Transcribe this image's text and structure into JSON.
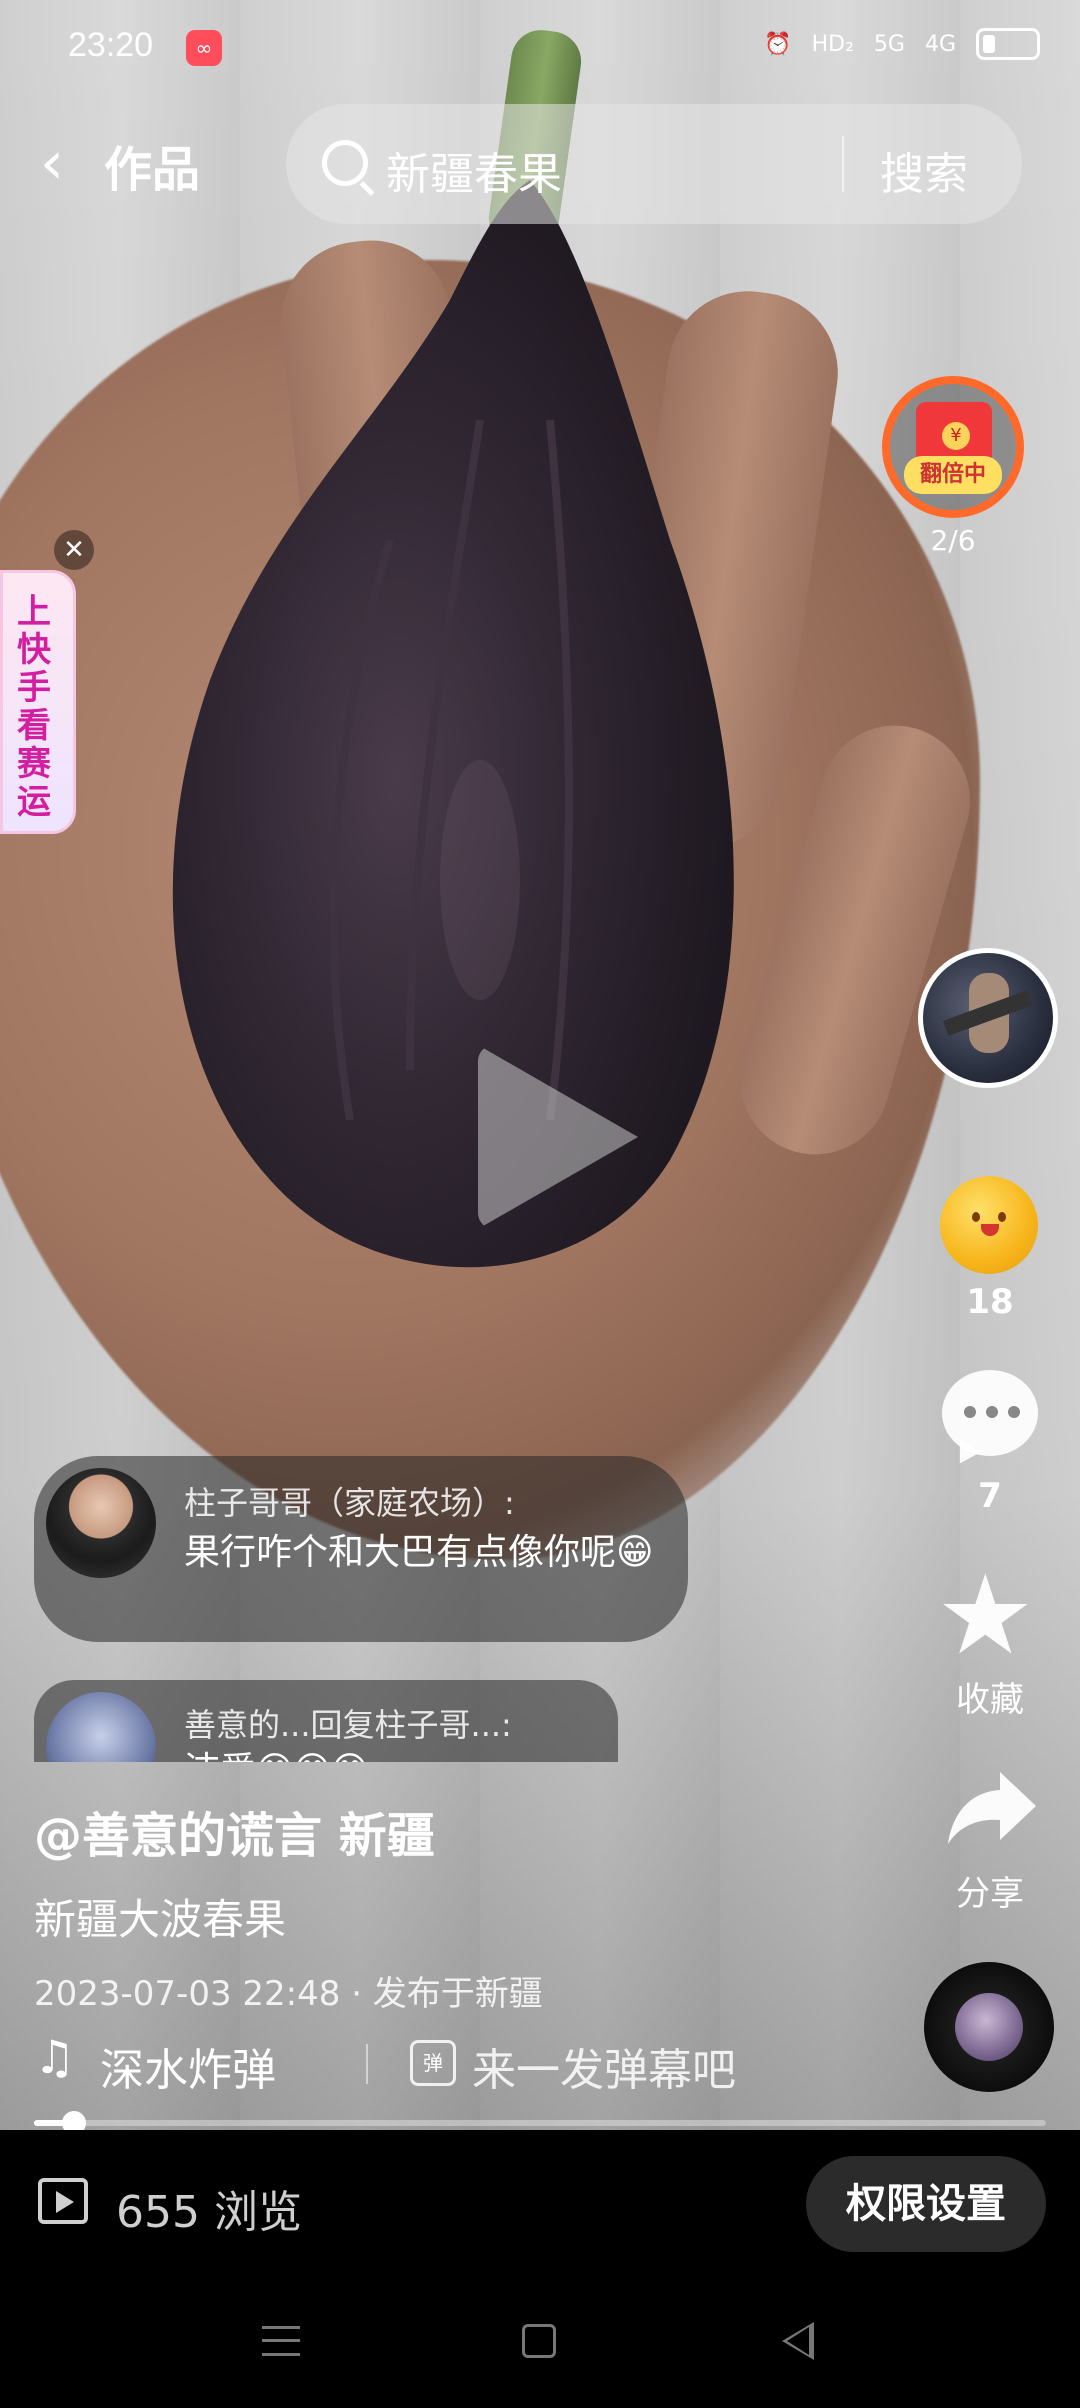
{
  "status_bar": {
    "time": "23:20",
    "app_badge_icon": "app-notification-icon",
    "indicators": [
      "alarm-icon",
      "HD",
      "5G",
      "4G",
      "battery-icon"
    ],
    "hd_label": "HD₂",
    "net1_label": "5G",
    "net2_label": "4G"
  },
  "top_bar": {
    "back_icon": "back-arrow-icon",
    "title": "作品",
    "search_query": "新疆春果",
    "search_button": "搜索"
  },
  "side_banner": {
    "text": "上快手 看赛运"
  },
  "right_rail": {
    "red_packet_tag": "翻倍中",
    "red_packet_progress": "2/6",
    "coin_count": "18",
    "comment_count": "7",
    "favorite_label": "收藏",
    "share_label": "分享"
  },
  "danmaku": [
    {
      "name": "柱子哥哥（家庭农场）:",
      "text": "果行咋个和大巴有点像你呢😁"
    },
    {
      "name": "善意的...回复柱子哥...:",
      "text": "洁爱😁😁😁"
    }
  ],
  "video": {
    "author": "@善意的谎言 新疆",
    "description": "新疆大波春果",
    "meta": "2023-07-03 22:48 · 发布于新疆",
    "music": "深水炸弹 - ",
    "danmaku_prompt": "来一发弹幕吧",
    "danmaku_icon_text": "弹",
    "progress": 0.04
  },
  "bottom_bar": {
    "views": "655 浏览",
    "permission_button": "权限设置"
  }
}
